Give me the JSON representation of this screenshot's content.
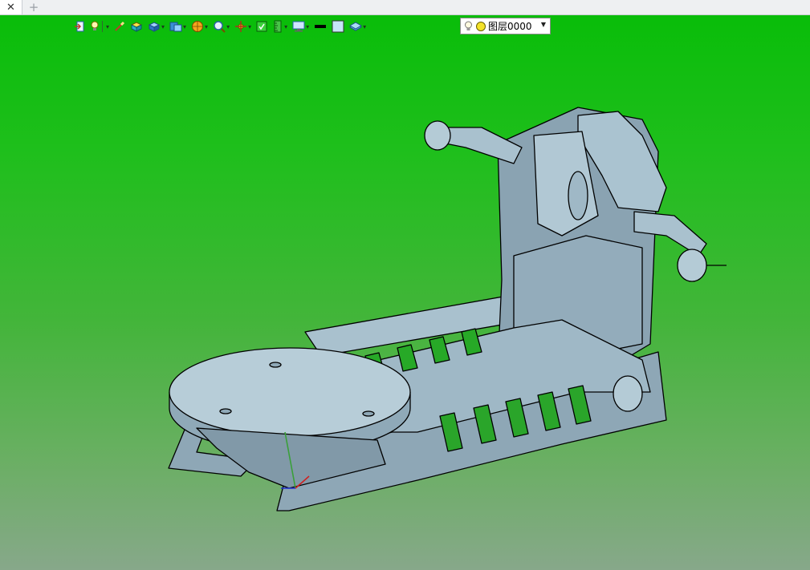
{
  "tabs": {
    "close_glyph": "✕",
    "new_glyph": "+"
  },
  "toolbar": {
    "icons": [
      "exit-sketch-icon",
      "light-bulb-icon",
      "brush-icon",
      "solid-box-icon",
      "view-cube-icon",
      "display-mode-icon",
      "sphere-render-icon",
      "zoom-fit-icon",
      "pan-rotate-icon",
      "green-square-icon",
      "ruler-icon",
      "monitor-icon",
      "line-color-swatch",
      "fill-color-swatch",
      "layer-stack-icon"
    ],
    "layer_combo": {
      "value": "图层0000"
    }
  },
  "colors": {
    "bg_top": "#09bd09",
    "bg_bottom": "#87a88a",
    "model_fill": "#9fb8c6",
    "model_edge": "#000000"
  }
}
